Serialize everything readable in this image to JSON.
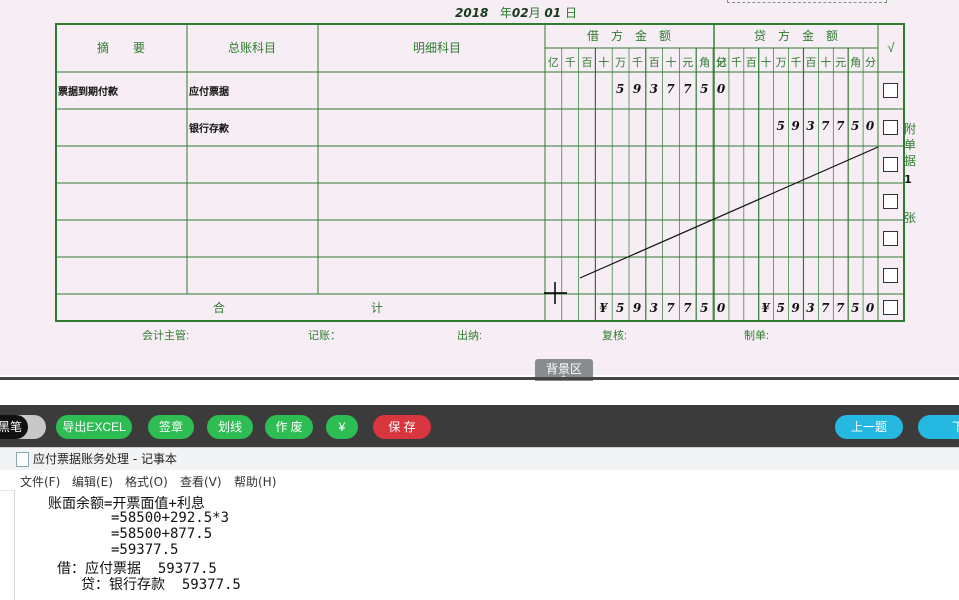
{
  "voucher": {
    "date": {
      "year": "2018",
      "year_label": "年",
      "month": "02",
      "month_label": "月",
      "day": "01",
      "day_label": "日"
    },
    "headers": {
      "summary": "摘　　要",
      "ledger": "总账科目",
      "detail": "明细科目",
      "debit": "借　方　金　额",
      "credit": "贷　方　金　额",
      "check": "√"
    },
    "digit_labels": [
      "亿",
      "千",
      "百",
      "十",
      "万",
      "千",
      "百",
      "十",
      "元",
      "角",
      "分"
    ],
    "rows": [
      {
        "summary": "票据到期付款",
        "ledger": "应付票据",
        "debit": [
          "",
          "",
          "",
          "",
          "5",
          "9",
          "3",
          "7",
          "7",
          "5",
          "0"
        ],
        "credit": [
          "",
          "",
          "",
          "",
          "",
          "",
          "",
          "",
          "",
          "",
          ""
        ]
      },
      {
        "summary": "",
        "ledger": "银行存款",
        "debit": [
          "",
          "",
          "",
          "",
          "",
          "",
          "",
          "",
          "",
          "",
          ""
        ],
        "credit": [
          "",
          "",
          "",
          "",
          "5",
          "9",
          "3",
          "7",
          "7",
          "5",
          "0"
        ]
      },
      {
        "summary": "",
        "ledger": "",
        "debit": [
          "",
          "",
          "",
          "",
          "",
          "",
          "",
          "",
          "",
          "",
          ""
        ],
        "credit": [
          "",
          "",
          "",
          "",
          "",
          "",
          "",
          "",
          "",
          "",
          ""
        ]
      },
      {
        "summary": "",
        "ledger": "",
        "debit": [
          "",
          "",
          "",
          "",
          "",
          "",
          "",
          "",
          "",
          "",
          ""
        ],
        "credit": [
          "",
          "",
          "",
          "",
          "",
          "",
          "",
          "",
          "",
          "",
          ""
        ]
      },
      {
        "summary": "",
        "ledger": "",
        "debit": [
          "",
          "",
          "",
          "",
          "",
          "",
          "",
          "",
          "",
          "",
          ""
        ],
        "credit": [
          "",
          "",
          "",
          "",
          "",
          "",
          "",
          "",
          "",
          "",
          ""
        ]
      },
      {
        "summary": "",
        "ledger": "",
        "debit": [
          "",
          "",
          "",
          "",
          "",
          "",
          "",
          "",
          "",
          "",
          ""
        ],
        "credit": [
          "",
          "",
          "",
          "",
          "",
          "",
          "",
          "",
          "",
          "",
          ""
        ]
      }
    ],
    "total": {
      "label_he": "合",
      "label_ji": "计",
      "debit": [
        "",
        "",
        "",
        "¥",
        "5",
        "9",
        "3",
        "7",
        "7",
        "5",
        "0"
      ],
      "credit": [
        "",
        "",
        "",
        "¥",
        "5",
        "9",
        "3",
        "7",
        "7",
        "5",
        "0"
      ]
    },
    "attachment": {
      "chars": [
        "附",
        "单",
        "据"
      ],
      "count": "1",
      "unit": "张"
    },
    "signatures": {
      "supervisor": "会计主管:",
      "bookkeeper": "记账：",
      "cashier": "出纳:",
      "reviewer": "复核:",
      "preparer": "制单:"
    },
    "background_tab": "背景区"
  },
  "toolbar": {
    "pen_label": "黑笔",
    "export_excel": "导出EXCEL",
    "sign": "签章",
    "strike": "划线",
    "void": "作 废",
    "yuan": "¥",
    "save": "保 存",
    "prev": "上一题",
    "next": "下"
  },
  "notepad": {
    "title": "应付票据账务处理 - 记事本",
    "menu": [
      "文件(F)",
      "编辑(E)",
      "格式(O)",
      "查看(V)",
      "帮助(H)"
    ],
    "lines": [
      "账面余额=开票面值+利息",
      "=58500+292.5*3",
      "=58500+877.5",
      "=59377.5",
      "借：应付票据  59377.5",
      "贷：银行存款  59377.5"
    ]
  },
  "colors": {
    "grid_green": "#2f7b2f",
    "voucher_bg": "#f6eef4",
    "toolbar_bg": "#3b3b3b",
    "green_btn": "#2dbd53",
    "red_btn": "#d8363f",
    "blue_btn": "#25b8e0"
  }
}
